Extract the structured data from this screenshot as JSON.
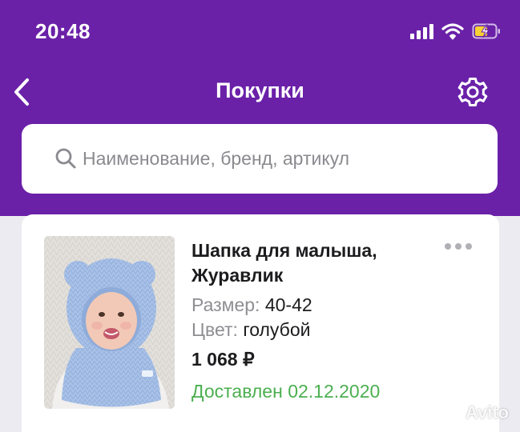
{
  "status_bar": {
    "time": "20:48"
  },
  "nav": {
    "title": "Покупки"
  },
  "search": {
    "placeholder": "Наименование, бренд, артикул"
  },
  "purchase": {
    "name": "Шапка для малыша, Журавлик",
    "size_label": "Размер:",
    "size_value": "40-42",
    "color_label": "Цвет:",
    "color_value": "голубой",
    "price": "1 068 ₽",
    "status": "Доставлен 02.12.2020"
  },
  "watermark": {
    "text": "Avito"
  },
  "icons": {
    "back": "chevron-left-icon",
    "settings": "gear-icon",
    "search": "search-icon",
    "more": "more-dots-icon"
  },
  "colors": {
    "header_bg": "#6a21a8",
    "status_delivered": "#4caf50",
    "page_bg": "#ecebf1"
  }
}
